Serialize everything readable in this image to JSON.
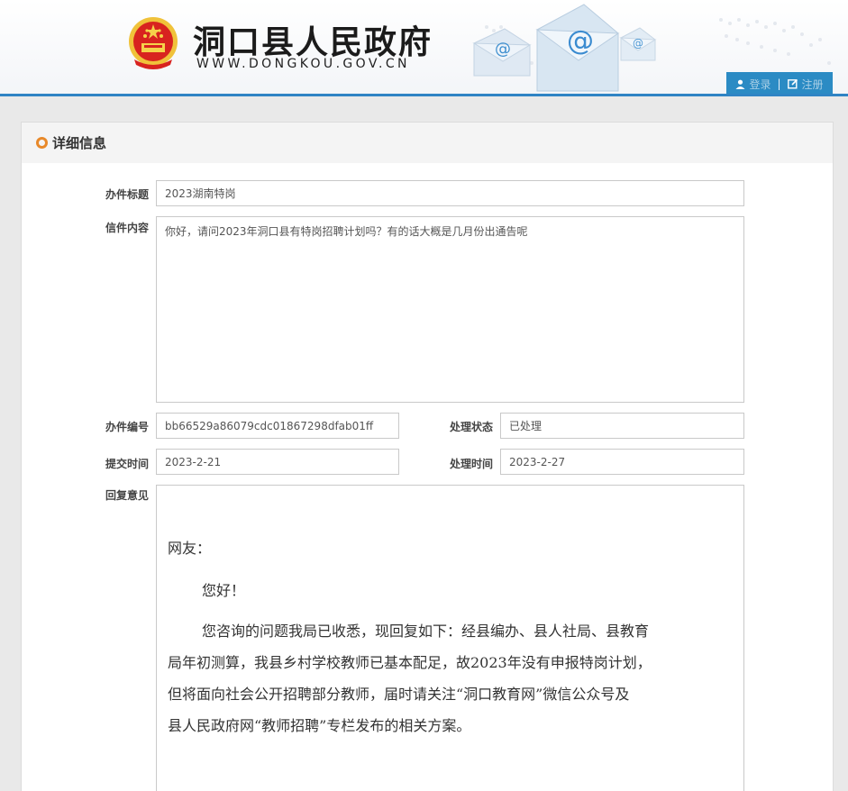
{
  "header": {
    "site_name": "洞口县人民政府",
    "site_url": "WWW.DONGKOU.GOV.CN",
    "user_links": {
      "login": "登录",
      "register": "注册"
    }
  },
  "panel": {
    "title": "详细信息",
    "fields": {
      "subject_label": "办件标题",
      "subject_value": "2023湖南特岗",
      "content_label": "信件内容",
      "content_value": "你好，请问2023年洞口县有特岗招聘计划吗？有的话大概是几月份出通告呢",
      "case_no_label": "办件编号",
      "case_no_value": "bb66529a86079cdc01867298dfab01ff",
      "status_label": "处理状态",
      "status_value": "已处理",
      "submit_time_label": "提交时间",
      "submit_time_value": "2023-2-21",
      "handle_time_label": "处理时间",
      "handle_time_value": "2023-2-27",
      "reply_label": "回复意见"
    },
    "reply": {
      "greeting": "网友：",
      "hello": "您好！",
      "line1": "您咨询的问题我局已收悉，现回复如下：经县编办、县人社局、县教育",
      "line2": "局年初测算，我县乡村学校教师已基本配足，故2023年没有申报特岗计划，",
      "line3": "但将面向社会公开招聘部分教师，届时请关注“洞口教育网”微信公众号及",
      "line4": "县人民政府网“教师招聘”专栏发布的相关方案。"
    }
  },
  "colors": {
    "accent_blue": "#2b8bc4",
    "header_line": "#2f84c4",
    "ring_orange": "#e8892a"
  }
}
